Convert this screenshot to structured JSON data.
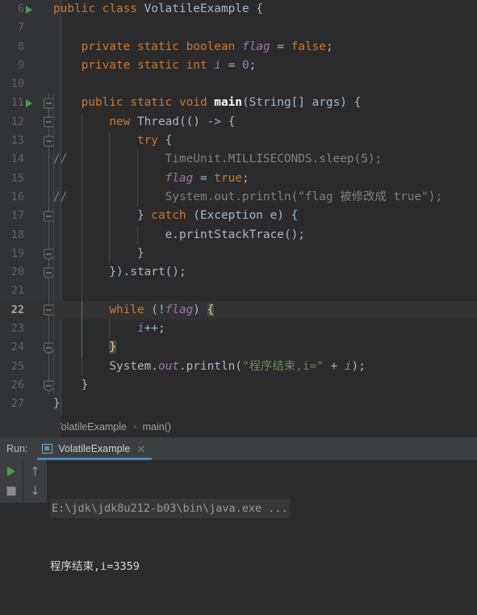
{
  "editor": {
    "first_line": 6,
    "current_line": 22,
    "lines": [
      {
        "n": 6,
        "run_icon": true,
        "fold": "none",
        "indent": 0,
        "text": "public class VolatileExample {"
      },
      {
        "n": 7,
        "run_icon": false,
        "fold": "none",
        "indent": 0,
        "text": ""
      },
      {
        "n": 8,
        "run_icon": false,
        "fold": "none",
        "indent": 1,
        "text": "private static boolean flag = false;"
      },
      {
        "n": 9,
        "run_icon": false,
        "fold": "none",
        "indent": 1,
        "text": "private static int i = 0;"
      },
      {
        "n": 10,
        "run_icon": false,
        "fold": "none",
        "indent": 1,
        "text": ""
      },
      {
        "n": 11,
        "run_icon": true,
        "fold": "start",
        "indent": 1,
        "text": "public static void main(String[] args) {"
      },
      {
        "n": 12,
        "run_icon": false,
        "fold": "start",
        "indent": 2,
        "text": "new Thread(() -> {"
      },
      {
        "n": 13,
        "run_icon": false,
        "fold": "start",
        "indent": 3,
        "text": "try {"
      },
      {
        "n": 14,
        "run_icon": false,
        "fold": "none",
        "indent": 4,
        "comment_marker": "//",
        "text": "TimeUnit.MILLISECONDS.sleep(5);"
      },
      {
        "n": 15,
        "run_icon": false,
        "fold": "none",
        "indent": 4,
        "text": "flag = true;"
      },
      {
        "n": 16,
        "run_icon": false,
        "fold": "none",
        "indent": 4,
        "comment_marker": "//",
        "text": "System.out.println(\"flag 被修改成 true\");"
      },
      {
        "n": 17,
        "run_icon": false,
        "fold": "start",
        "indent": 3,
        "text": "} catch (Exception e) {"
      },
      {
        "n": 18,
        "run_icon": false,
        "fold": "none",
        "indent": 4,
        "text": "e.printStackTrace();"
      },
      {
        "n": 19,
        "run_icon": false,
        "fold": "end",
        "indent": 3,
        "text": "}"
      },
      {
        "n": 20,
        "run_icon": false,
        "fold": "end",
        "indent": 2,
        "text": "}).start();"
      },
      {
        "n": 21,
        "run_icon": false,
        "fold": "none",
        "indent": 2,
        "text": ""
      },
      {
        "n": 22,
        "run_icon": false,
        "fold": "start",
        "indent": 2,
        "text": "while (!flag) {"
      },
      {
        "n": 23,
        "run_icon": false,
        "fold": "none",
        "indent": 3,
        "text": "i++;"
      },
      {
        "n": 24,
        "run_icon": false,
        "fold": "end",
        "indent": 2,
        "text": "}"
      },
      {
        "n": 25,
        "run_icon": false,
        "fold": "none",
        "indent": 2,
        "text": "System.out.println(\"程序结束,i=\" + i);"
      },
      {
        "n": 26,
        "run_icon": false,
        "fold": "end",
        "indent": 1,
        "text": "}"
      },
      {
        "n": 27,
        "run_icon": false,
        "fold": "none",
        "indent": 0,
        "text": "}"
      }
    ]
  },
  "breadcrumb": {
    "class_name": "VolatileExample",
    "separator": "›",
    "method_name": "main()"
  },
  "run_window": {
    "label": "Run:",
    "tab_title": "VolatileExample",
    "close_glyph": "✕",
    "rerun_icon": "play-icon",
    "stop_icon": "stop-icon",
    "up_glyph": "↑",
    "down_glyph": "↓",
    "console": {
      "command_line": "E:\\jdk\\jdk8u212-b03\\bin\\java.exe ...",
      "output_line": "程序结束,i=3359"
    }
  },
  "colors": {
    "editor_bg": "#2b2b2b",
    "gutter_bg": "#313335",
    "current_line_bg": "#323232",
    "keyword": "#cc7832",
    "field": "#9876aa",
    "number": "#6897bb",
    "string": "#6a8759",
    "comment": "#808080",
    "default_text": "#a9b7c6",
    "run_green": "#499c54",
    "tab_underline": "#4a88c7",
    "brace_highlight": "#3b514d"
  }
}
